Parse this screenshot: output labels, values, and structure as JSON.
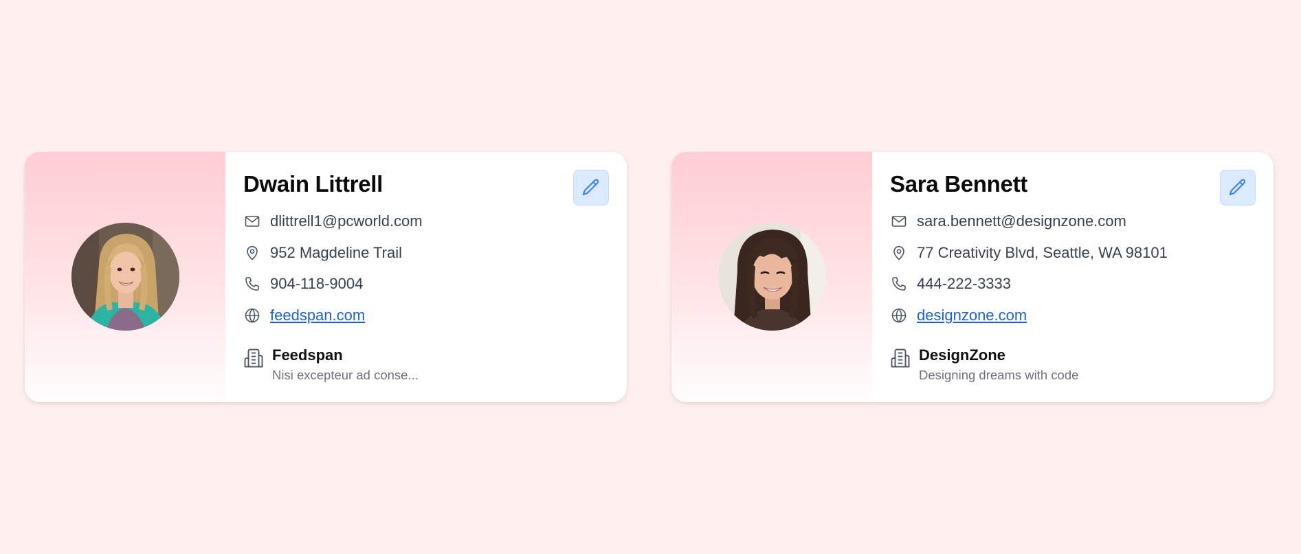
{
  "colors": {
    "page_background": "#fff0f0",
    "card_background": "#ffffff",
    "side_gradient_top": "#ffcdd3",
    "edit_button_bg": "#dbeafe",
    "edit_icon": "#3b82f6",
    "link": "#1d5fd6",
    "icon": "#4b5563"
  },
  "cards": [
    {
      "name": "Dwain Littrell",
      "email": "dlittrell1@pcworld.com",
      "address": "952 Magdeline Trail",
      "phone": "904-118-9004",
      "website": "feedspan.com",
      "company": {
        "name": "Feedspan",
        "tagline": "Nisi excepteur ad conse..."
      },
      "icons": {
        "edit": "pencil-icon",
        "email": "mail-icon",
        "address": "map-pin-icon",
        "phone": "phone-icon",
        "website": "globe-icon",
        "company": "building-icon"
      }
    },
    {
      "name": "Sara Bennett",
      "email": "sara.bennett@designzone.com",
      "address": "77 Creativity Blvd, Seattle, WA 98101",
      "phone": "444-222-3333",
      "website": "designzone.com",
      "company": {
        "name": "DesignZone",
        "tagline": "Designing dreams with code"
      },
      "icons": {
        "edit": "pencil-icon",
        "email": "mail-icon",
        "address": "map-pin-icon",
        "phone": "phone-icon",
        "website": "globe-icon",
        "company": "building-icon"
      }
    }
  ]
}
